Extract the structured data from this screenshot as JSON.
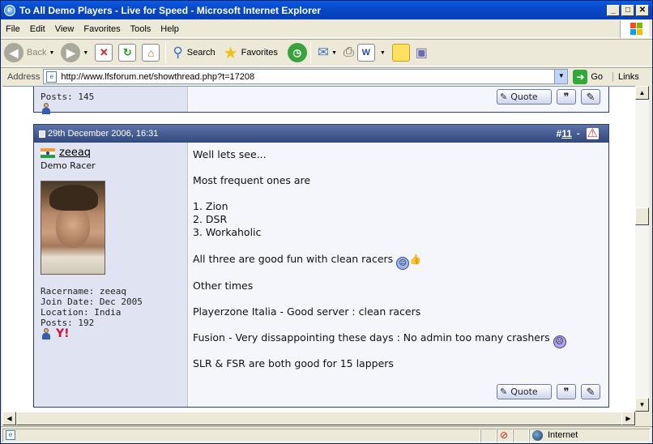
{
  "window": {
    "title": "To All Demo Players - Live for Speed - Microsoft Internet Explorer"
  },
  "menu": [
    "File",
    "Edit",
    "View",
    "Favorites",
    "Tools",
    "Help"
  ],
  "toolbar": {
    "back": "Back",
    "search": "Search",
    "favorites": "Favorites"
  },
  "address": {
    "label": "Address",
    "url": "http://www.lfsforum.net/showthread.php?t=17208",
    "go": "Go",
    "links": "Links"
  },
  "prev_post": {
    "posts": "Posts: 145",
    "quote": "Quote"
  },
  "post": {
    "date": "29th December 2006, 16:31",
    "number_prefix": "#",
    "number": "11",
    "number_suffix": "-",
    "username": "zeeaq",
    "user_title": "Demo Racer",
    "racername": "Racername: zeeaq",
    "join_date": "Join Date: Dec 2005",
    "location": "Location: India",
    "posts": "Posts: 192",
    "lines": [
      "Well lets see...",
      "Most frequent ones are",
      "1. Zion",
      "2. DSR",
      "3. Workaholic",
      "All three are good fun with clean racers",
      "Other times",
      "Playerzone Italia - Good server : clean racers",
      "Fusion - Very dissappointing these days : No admin too many crashers",
      "SLR & FSR are both good for 15 lappers"
    ],
    "quote": "Quote"
  },
  "status": {
    "zone": "Internet"
  },
  "colors": {
    "header": "#33497e",
    "user_panel": "#e0e4f2",
    "message_bg": "#f5f6fb"
  },
  "icons": {
    "report": "warning-icon",
    "smiley1": "thumbs-up-smiley-icon",
    "smiley2": "sad-smiley-icon"
  }
}
